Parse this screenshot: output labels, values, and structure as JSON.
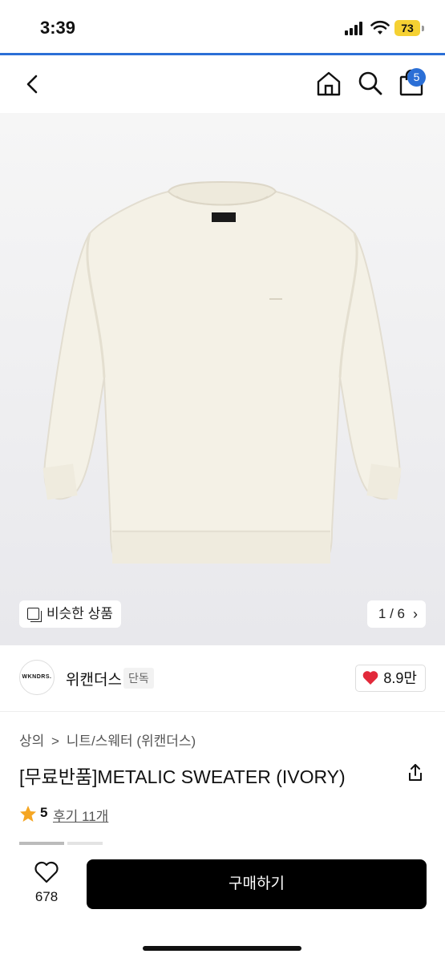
{
  "status": {
    "time": "3:39",
    "battery": "73"
  },
  "nav": {
    "cart_count": "5"
  },
  "hero": {
    "similar_label": "비슷한 상품",
    "pager": "1 / 6"
  },
  "brand": {
    "logo_text": "WKNDRS.",
    "name": "위캔더스",
    "tag": "단독",
    "likes": "8.9만"
  },
  "breadcrumb": {
    "level1": "상의",
    "separator": ">",
    "level2": "니트/스웨터 (위캔더스)"
  },
  "product": {
    "title": "[무료반품]METALIC SWEATER (IVORY)",
    "rating": "5",
    "reviews": "후기 11개"
  },
  "bottom": {
    "wish_count": "678",
    "buy_label": "구매하기"
  },
  "colors": {
    "accent": "#2b6fd6",
    "heart": "#e2293a",
    "star": "#f5a623",
    "buy_bg": "#000000"
  },
  "icons": [
    "back-arrow-icon",
    "home-icon",
    "search-icon",
    "shopping-bag-icon",
    "similar-items-icon",
    "chevron-right-icon",
    "heart-icon",
    "share-icon",
    "star-icon",
    "wishlist-heart-icon"
  ]
}
